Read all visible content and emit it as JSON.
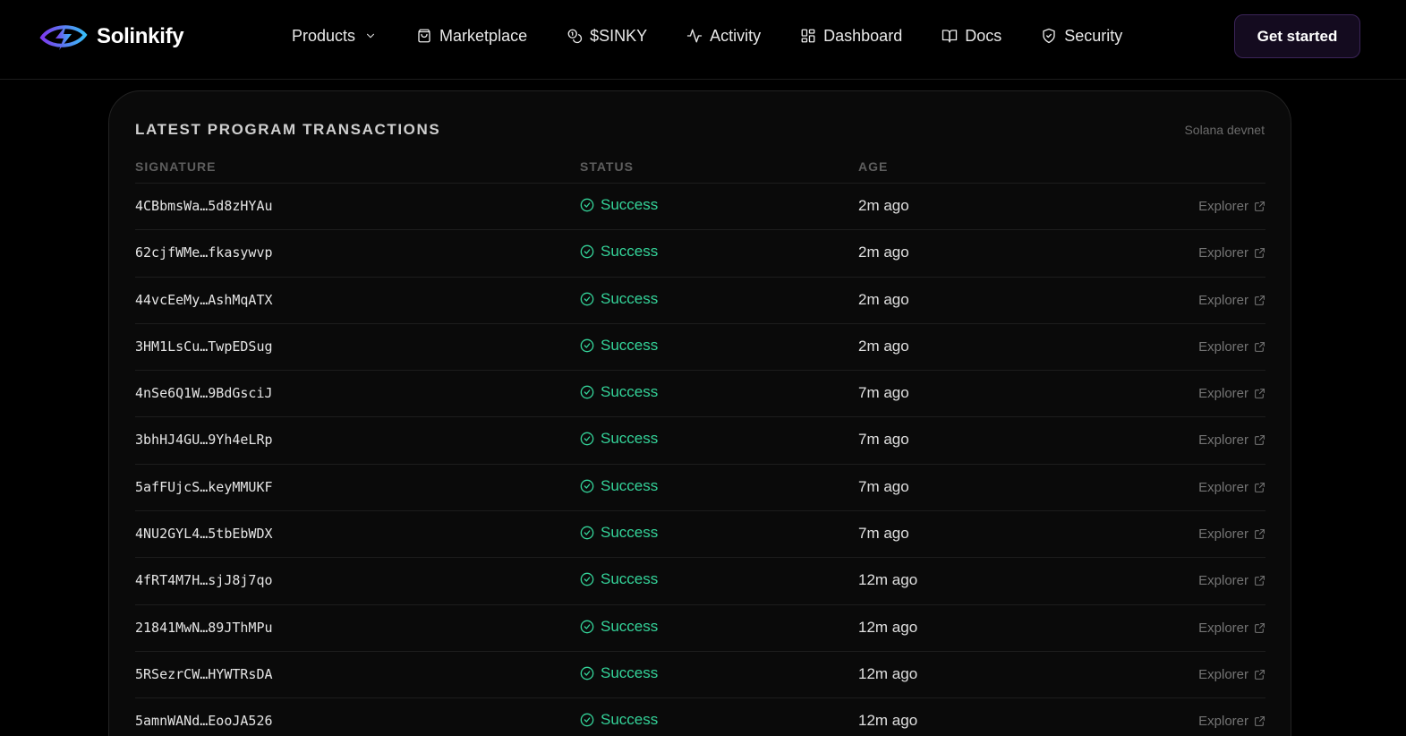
{
  "brand": {
    "name": "Solinkify",
    "logo_icon": "lightning-eye-logo",
    "accent_purple": "#7c3aed",
    "accent_cyan": "#38bdf8"
  },
  "nav": {
    "products": "Products",
    "marketplace": "Marketplace",
    "token": "$SINKY",
    "activity": "Activity",
    "dashboard": "Dashboard",
    "docs": "Docs",
    "security": "Security"
  },
  "cta": "Get started",
  "card": {
    "title": "LATEST PROGRAM TRANSACTIONS",
    "network": "Solana devnet",
    "columns": {
      "signature": "SIGNATURE",
      "status": "STATUS",
      "age": "AGE"
    },
    "status_color": "#34d399",
    "rows": [
      {
        "signature": "4CBbmsWa…5d8zHYAu",
        "status": "Success",
        "age": "2m ago",
        "link": "Explorer"
      },
      {
        "signature": "62cjfWMe…fkasywvp",
        "status": "Success",
        "age": "2m ago",
        "link": "Explorer"
      },
      {
        "signature": "44vcEeMy…AshMqATX",
        "status": "Success",
        "age": "2m ago",
        "link": "Explorer"
      },
      {
        "signature": "3HM1LsCu…TwpEDSug",
        "status": "Success",
        "age": "2m ago",
        "link": "Explorer"
      },
      {
        "signature": "4nSe6Q1W…9BdGsciJ",
        "status": "Success",
        "age": "7m ago",
        "link": "Explorer"
      },
      {
        "signature": "3bhHJ4GU…9Yh4eLRp",
        "status": "Success",
        "age": "7m ago",
        "link": "Explorer"
      },
      {
        "signature": "5afFUjcS…keyMMUKF",
        "status": "Success",
        "age": "7m ago",
        "link": "Explorer"
      },
      {
        "signature": "4NU2GYL4…5tbEbWDX",
        "status": "Success",
        "age": "7m ago",
        "link": "Explorer"
      },
      {
        "signature": "4fRT4M7H…sjJ8j7qo",
        "status": "Success",
        "age": "12m ago",
        "link": "Explorer"
      },
      {
        "signature": "21841MwN…89JThMPu",
        "status": "Success",
        "age": "12m ago",
        "link": "Explorer"
      },
      {
        "signature": "5RSezrCW…HYWTRsDA",
        "status": "Success",
        "age": "12m ago",
        "link": "Explorer"
      },
      {
        "signature": "5amnWANd…EooJA526",
        "status": "Success",
        "age": "12m ago",
        "link": "Explorer"
      }
    ]
  }
}
